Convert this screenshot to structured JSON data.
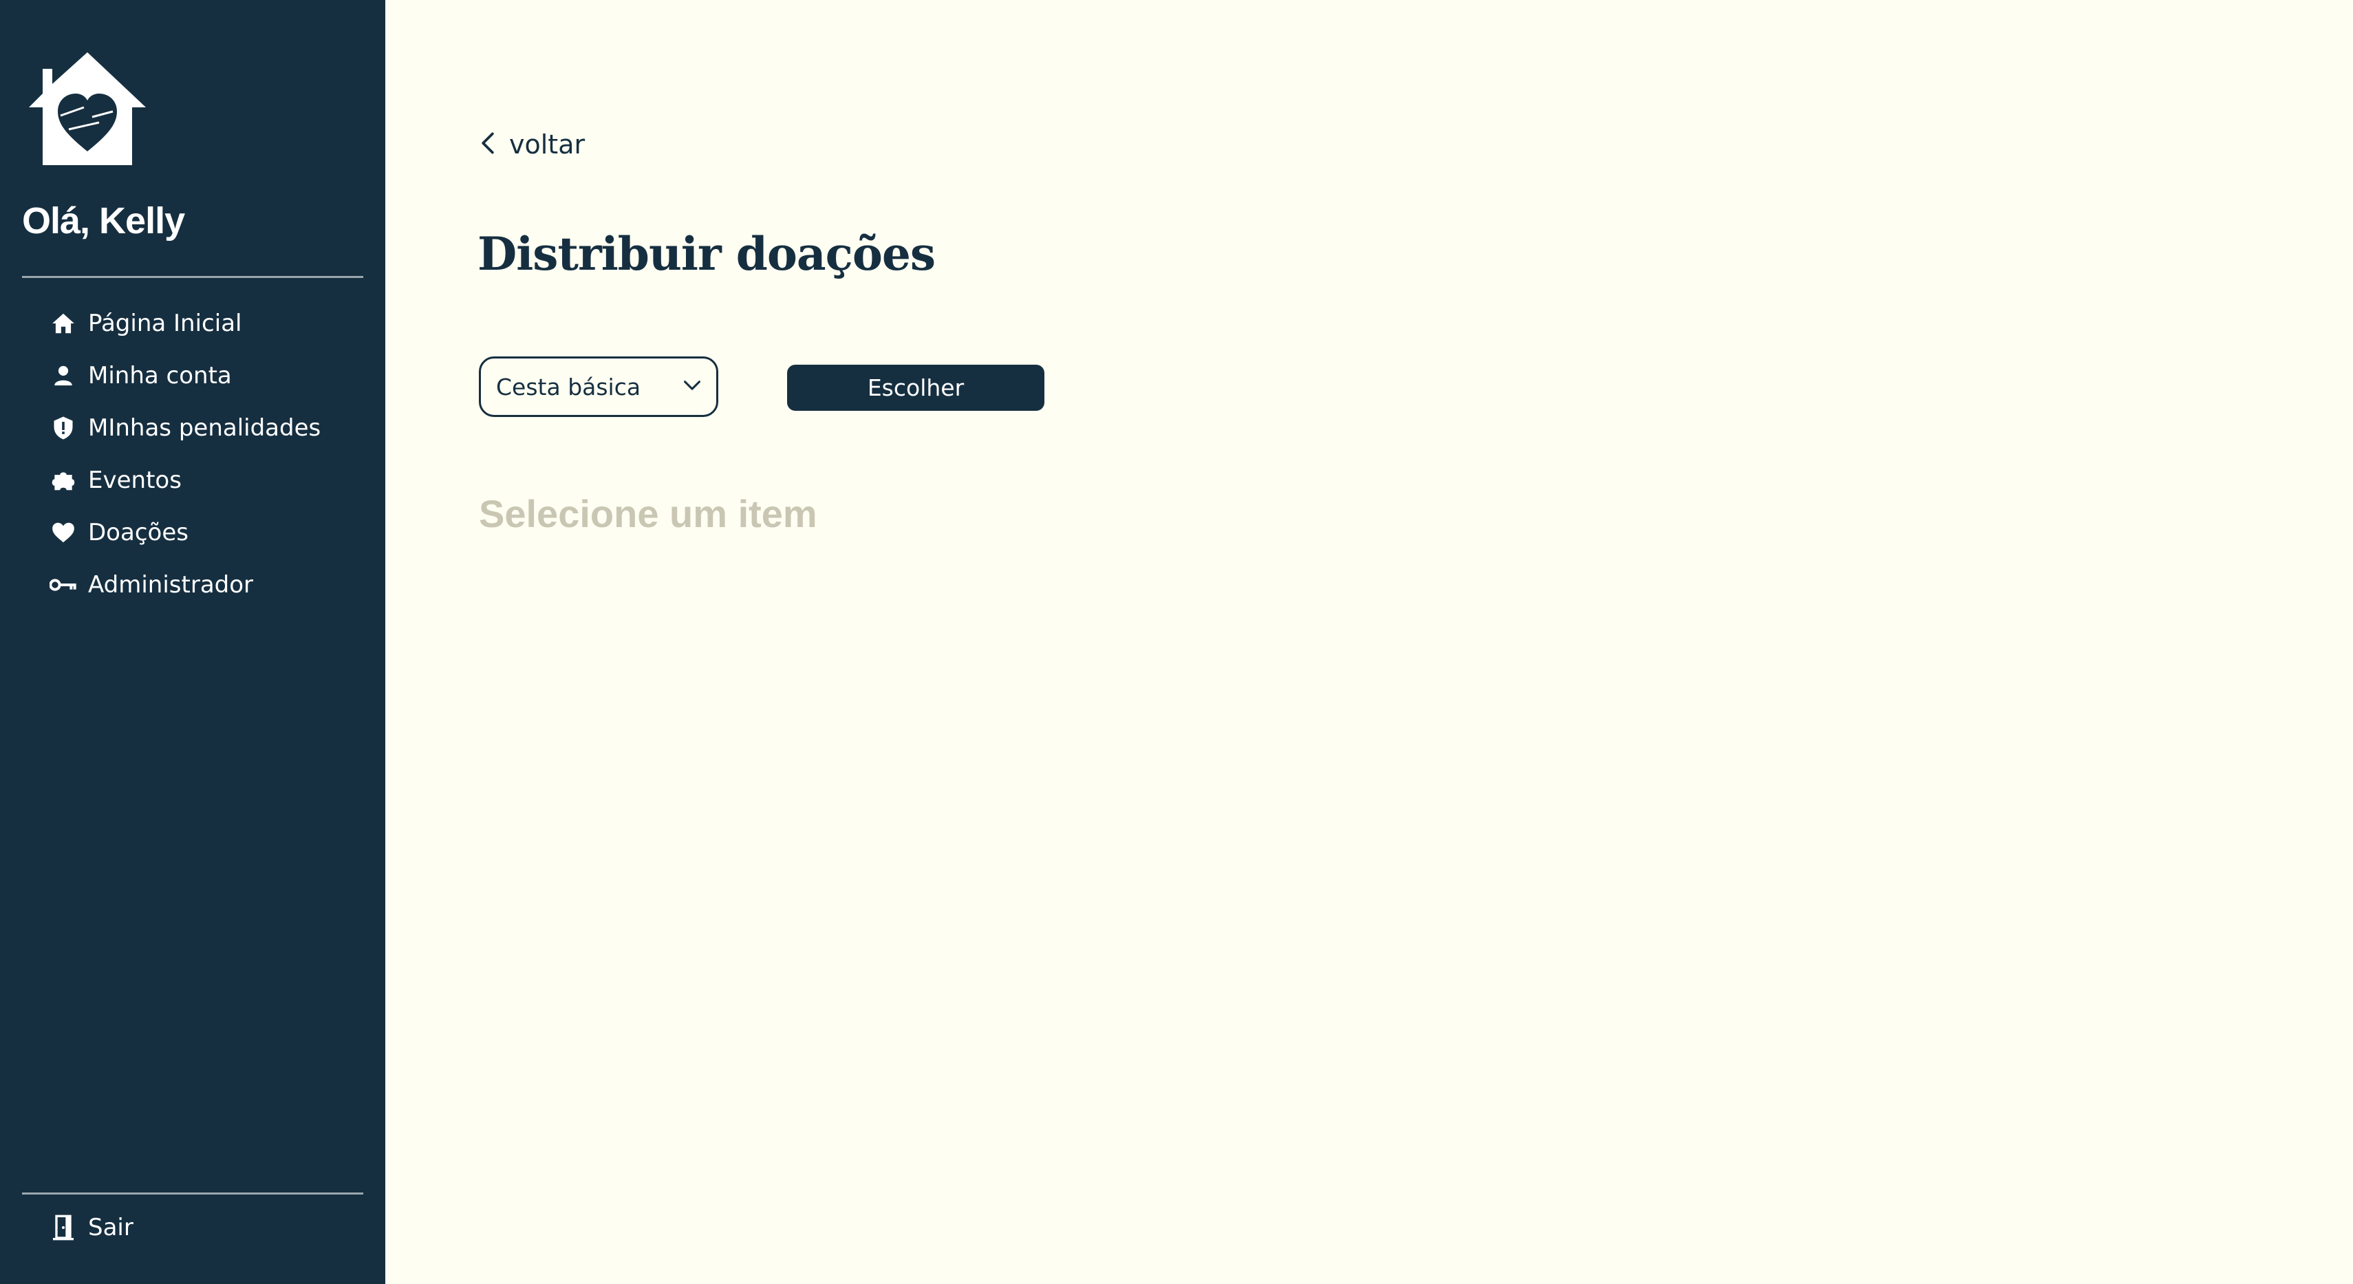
{
  "sidebar": {
    "logo_icon": "house-heart-logo-icon",
    "greeting": "Olá, Kelly",
    "items": [
      {
        "label": "Página Inicial",
        "icon": "home-icon"
      },
      {
        "label": "Minha conta",
        "icon": "user-icon"
      },
      {
        "label": "MInhas penalidades",
        "icon": "shield-alert-icon"
      },
      {
        "label": "Eventos",
        "icon": "puzzle-icon"
      },
      {
        "label": "Doações",
        "icon": "heart-icon"
      },
      {
        "label": "Administrador",
        "icon": "key-icon"
      }
    ],
    "logout": {
      "label": "Sair",
      "icon": "door-exit-icon"
    }
  },
  "main": {
    "back_label": "voltar",
    "title": "Distribuir doações",
    "select": {
      "value": "Cesta básica"
    },
    "choose_button": "Escolher",
    "empty_state": "Selecione um item"
  },
  "colors": {
    "sidebar_bg": "#162f40",
    "page_bg": "#fefef2",
    "primary": "#162f40",
    "muted_text": "#c9c7b3"
  }
}
